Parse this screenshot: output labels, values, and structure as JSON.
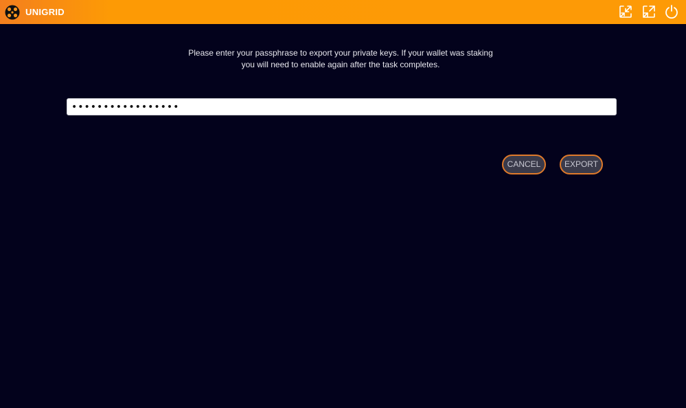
{
  "app": {
    "title": "UNIGRID"
  },
  "titlebar": {
    "logo_icon": "unigrid-logo",
    "controls": [
      {
        "icon": "minimize-window-icon"
      },
      {
        "icon": "maximize-window-icon"
      },
      {
        "icon": "power-icon"
      }
    ]
  },
  "dialog": {
    "message_line1": "Please enter your passphrase to export your private keys. If your wallet was staking",
    "message_line2": "you will need to enable again after the task completes.",
    "passphrase_value": "•••••••••••••••••",
    "cancel_label": "CANCEL",
    "export_label": "EXPORT"
  },
  "colors": {
    "titlebar": "#fd9a06",
    "background": "#03021c",
    "button_border": "#e07a2a",
    "button_fill": "#3a3a4a"
  }
}
